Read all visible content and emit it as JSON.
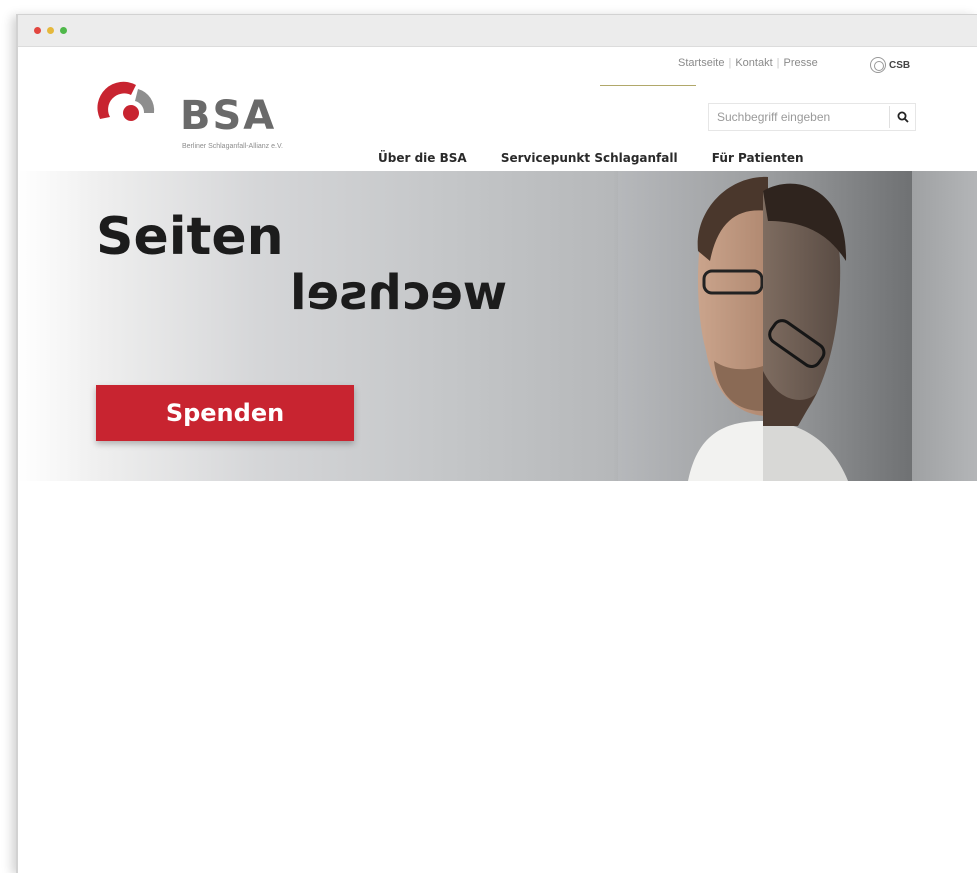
{
  "window": {
    "traffic_lights": [
      "close",
      "minimize",
      "maximize"
    ]
  },
  "brand": {
    "name": "BSA",
    "tagline": "Berliner Schlaganfall-Allianz e.V.",
    "colors": {
      "accent_red": "#c82430",
      "logo_gray": "#6a6a6a",
      "olive_line": "#b1a86a"
    }
  },
  "topnav": {
    "items": [
      "Startseite",
      "Kontakt",
      "Presse"
    ],
    "csb_label": "CSB"
  },
  "search": {
    "placeholder": "Suchbegriff eingeben",
    "icon": "search-icon"
  },
  "mainnav": {
    "items": [
      "Über die BSA",
      "Servicepunkt Schlaganfall",
      "Für Patienten"
    ]
  },
  "hero": {
    "headline_line1": "Seiten",
    "headline_line2_mirrored": "wechsel",
    "cta_label": "Spenden"
  }
}
